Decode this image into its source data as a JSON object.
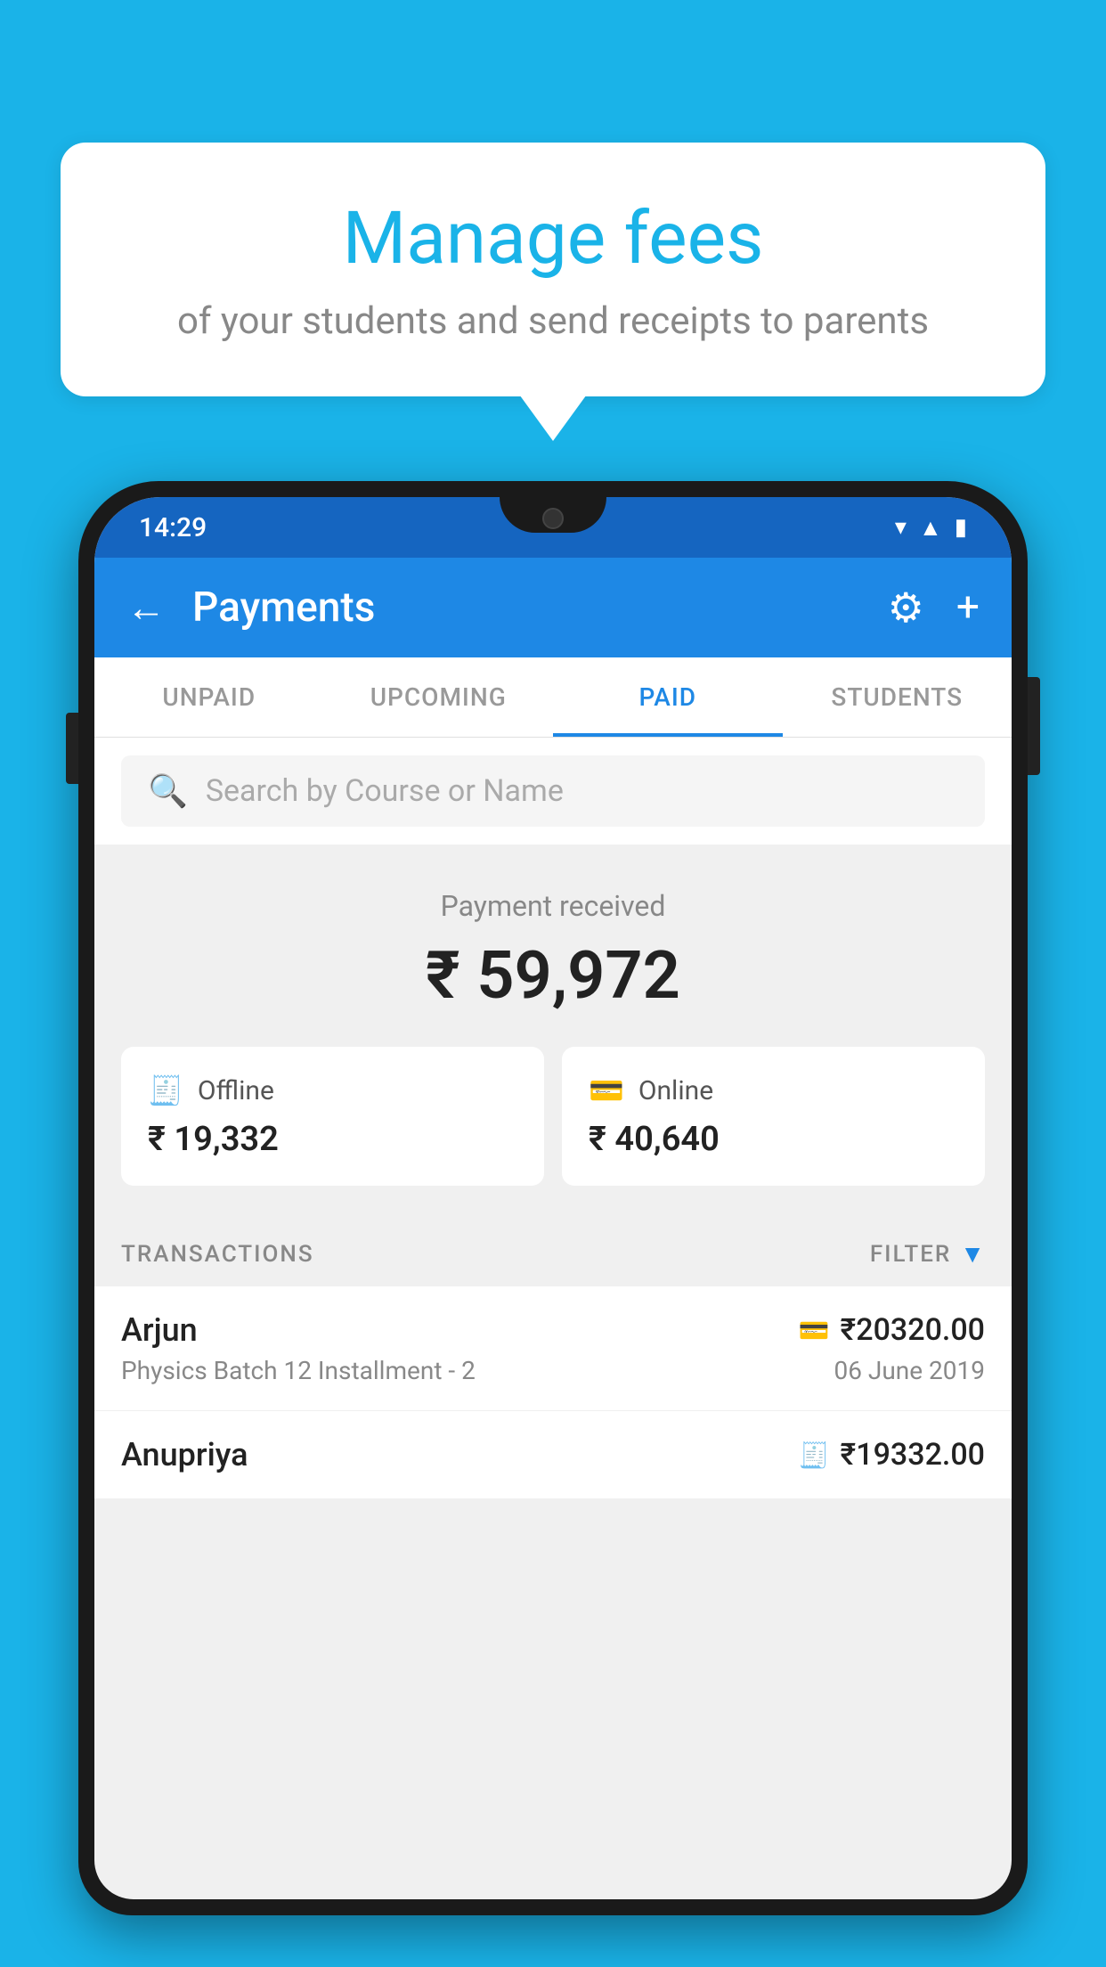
{
  "background_color": "#1ab3e8",
  "bubble": {
    "title": "Manage fees",
    "subtitle": "of your students and send receipts to parents"
  },
  "status_bar": {
    "time": "14:29",
    "icons": [
      "wifi",
      "signal",
      "battery"
    ]
  },
  "app_bar": {
    "back_label": "←",
    "title": "Payments",
    "gear_label": "⚙",
    "plus_label": "+"
  },
  "tabs": [
    {
      "id": "unpaid",
      "label": "UNPAID",
      "active": false
    },
    {
      "id": "upcoming",
      "label": "UPCOMING",
      "active": false
    },
    {
      "id": "paid",
      "label": "PAID",
      "active": true
    },
    {
      "id": "students",
      "label": "STUDENTS",
      "active": false
    }
  ],
  "search": {
    "placeholder": "Search by Course or Name"
  },
  "payment_summary": {
    "label": "Payment received",
    "amount": "₹ 59,972",
    "offline": {
      "label": "Offline",
      "amount": "₹ 19,332"
    },
    "online": {
      "label": "Online",
      "amount": "₹ 40,640"
    }
  },
  "transactions": {
    "header_label": "TRANSACTIONS",
    "filter_label": "FILTER",
    "rows": [
      {
        "name": "Arjun",
        "course": "Physics Batch 12 Installment - 2",
        "amount": "₹20320.00",
        "date": "06 June 2019",
        "payment_type": "card"
      },
      {
        "name": "Anupriya",
        "course": "",
        "amount": "₹19332.00",
        "date": "",
        "payment_type": "cash"
      }
    ]
  }
}
